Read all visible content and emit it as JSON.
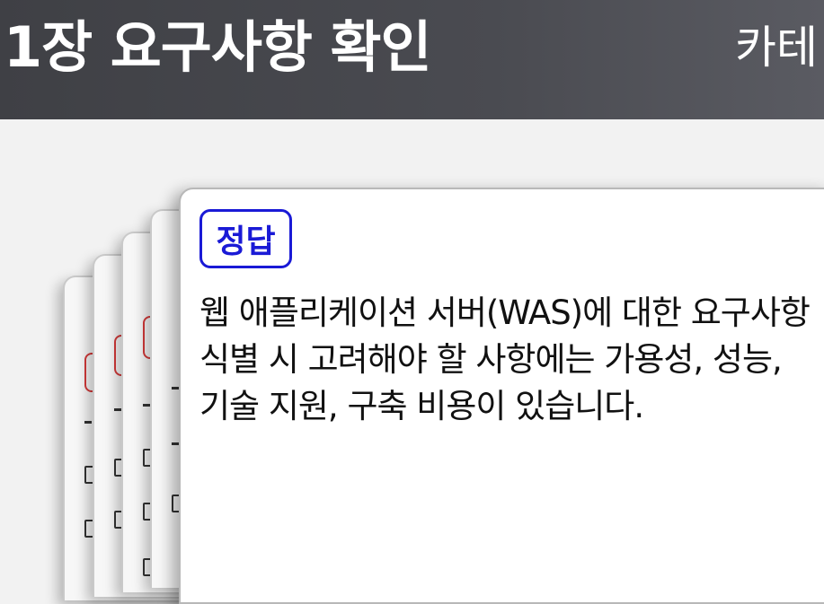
{
  "header": {
    "title": "1장 요구사항 확인",
    "category_label": "카테"
  },
  "card": {
    "badge_label": "정답",
    "answer_text": "웹 애플리케이션 서버(WAS)에 대한 요구사항 식별 시 고려해야 할 사항에는 가용성, 성능, 기술 지원, 구축 비용이 있습니다."
  },
  "colors": {
    "header_bg": "#4a4b51",
    "badge_color": "#1a1ad6",
    "stacked_badge_color": "#d43a3a"
  }
}
